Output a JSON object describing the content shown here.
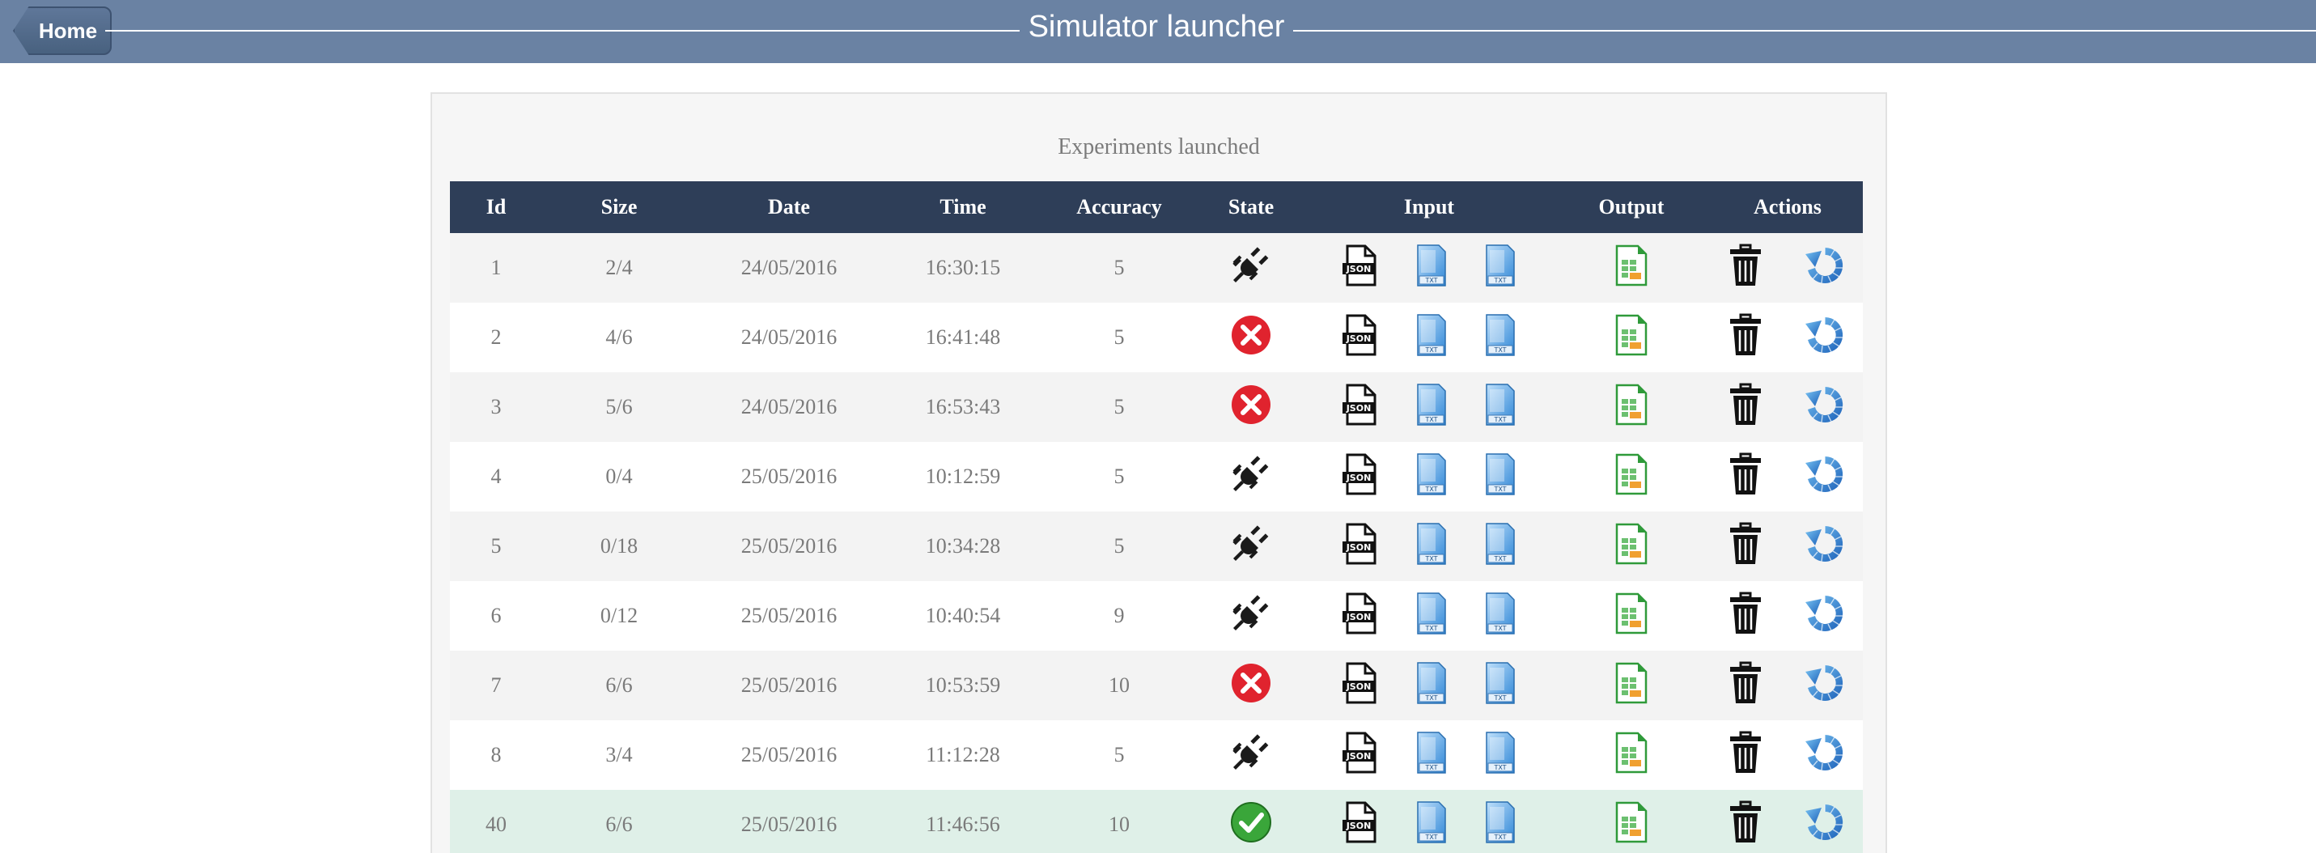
{
  "header": {
    "home_label": "Home",
    "title": "Simulator launcher"
  },
  "panel": {
    "title": "Experiments launched"
  },
  "table": {
    "columns": [
      "Id",
      "Size",
      "Date",
      "Time",
      "Accuracy",
      "State",
      "Input",
      "Output",
      "Actions"
    ],
    "rows": [
      {
        "id": "1",
        "size": "2/4",
        "date": "24/05/2016",
        "time": "16:30:15",
        "accuracy": "5",
        "state": "running"
      },
      {
        "id": "2",
        "size": "4/6",
        "date": "24/05/2016",
        "time": "16:41:48",
        "accuracy": "5",
        "state": "error"
      },
      {
        "id": "3",
        "size": "5/6",
        "date": "24/05/2016",
        "time": "16:53:43",
        "accuracy": "5",
        "state": "error"
      },
      {
        "id": "4",
        "size": "0/4",
        "date": "25/05/2016",
        "time": "10:12:59",
        "accuracy": "5",
        "state": "running"
      },
      {
        "id": "5",
        "size": "0/18",
        "date": "25/05/2016",
        "time": "10:34:28",
        "accuracy": "5",
        "state": "running"
      },
      {
        "id": "6",
        "size": "0/12",
        "date": "25/05/2016",
        "time": "10:40:54",
        "accuracy": "9",
        "state": "running"
      },
      {
        "id": "7",
        "size": "6/6",
        "date": "25/05/2016",
        "time": "10:53:59",
        "accuracy": "10",
        "state": "error"
      },
      {
        "id": "8",
        "size": "3/4",
        "date": "25/05/2016",
        "time": "11:12:28",
        "accuracy": "5",
        "state": "running"
      },
      {
        "id": "40",
        "size": "6/6",
        "date": "25/05/2016",
        "time": "11:46:56",
        "accuracy": "10",
        "state": "success"
      }
    ]
  },
  "icons": {
    "running": "plug-icon",
    "error": "error-x-icon",
    "success": "check-icon",
    "json": "json-file-icon",
    "txt": "txt-file-icon",
    "output": "spreadsheet-icon",
    "delete": "trash-icon",
    "relaunch": "refresh-icon"
  },
  "colors": {
    "topbar": "#6a82a3",
    "table_header": "#2e3e58",
    "success_row": "#dff0e8",
    "error": "#e0232e",
    "success": "#3aa63a"
  }
}
